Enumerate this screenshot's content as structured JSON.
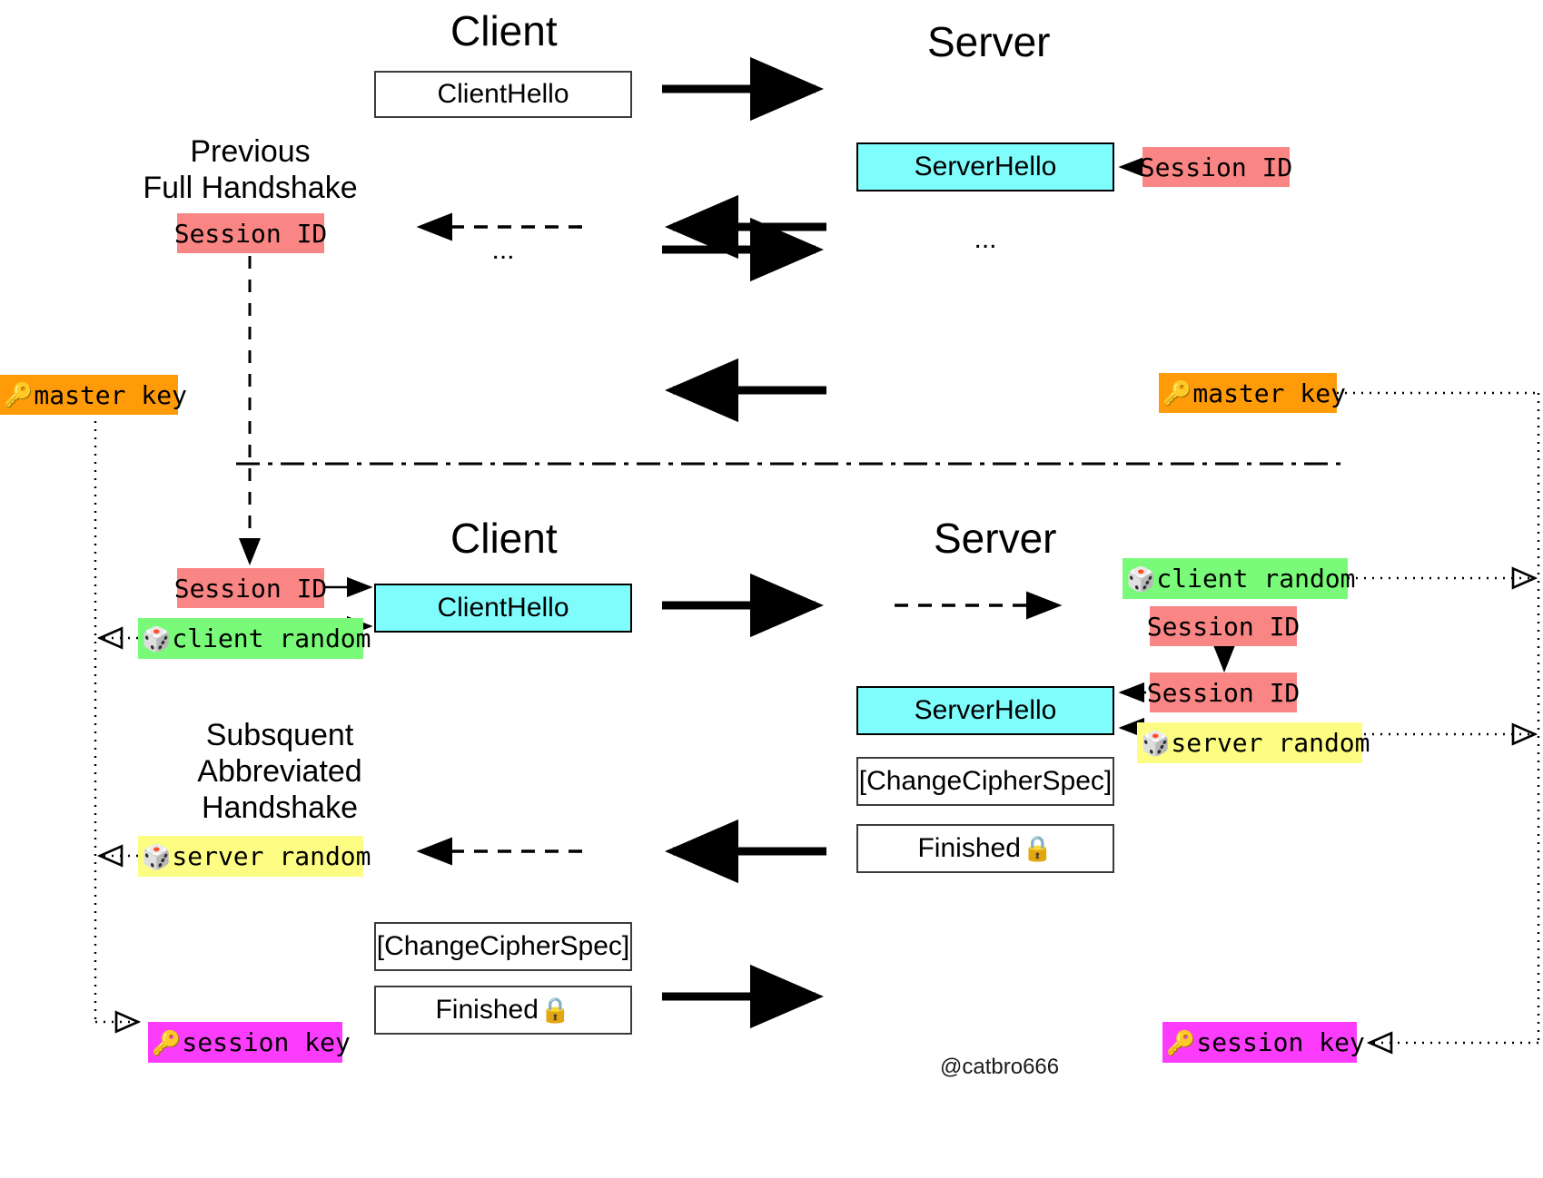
{
  "diagram": {
    "watermark": "@catbro666",
    "colors": {
      "session_id": "#fa8585",
      "hello_box": "#7ffdfd",
      "client_random": "#79fb79",
      "server_random": "#fdfd83",
      "master_key": "#ff9b09",
      "session_key": "#fc3cfc",
      "outline": "#3b3b3b"
    }
  },
  "full_handshake": {
    "caption": "Previous\nFull Handshake",
    "client_title": "Client",
    "server_title": "Server",
    "client_hello": "ClientHello",
    "server_hello": "ServerHello",
    "session_id_server": "Session ID",
    "session_id_client": "Session ID",
    "ellipsis_client": "...",
    "ellipsis_server": "...",
    "master_key_client": "master key",
    "master_key_server": "master key"
  },
  "abbreviated_handshake": {
    "caption": "Subsquent\nAbbreviated Handshake",
    "client_title": "Client",
    "server_title": "Server",
    "client_session_id": "Session ID",
    "client_random": "client random",
    "client_hello": "ClientHello",
    "server_client_random": "client random",
    "server_session_id_received": "Session ID",
    "server_session_id_resumed": "Session ID",
    "server_hello": "ServerHello",
    "server_random": "server random",
    "server_change_cipher_spec": "[ChangeCipherSpec]",
    "server_finished": "Finished",
    "client_server_random": "server random",
    "client_change_cipher_spec": "[ChangeCipherSpec]",
    "client_finished": "Finished",
    "session_key_client": "session key",
    "session_key_server": "session key"
  },
  "icons": {
    "key": "🔑",
    "die": "🎲",
    "lock": "🔒"
  }
}
